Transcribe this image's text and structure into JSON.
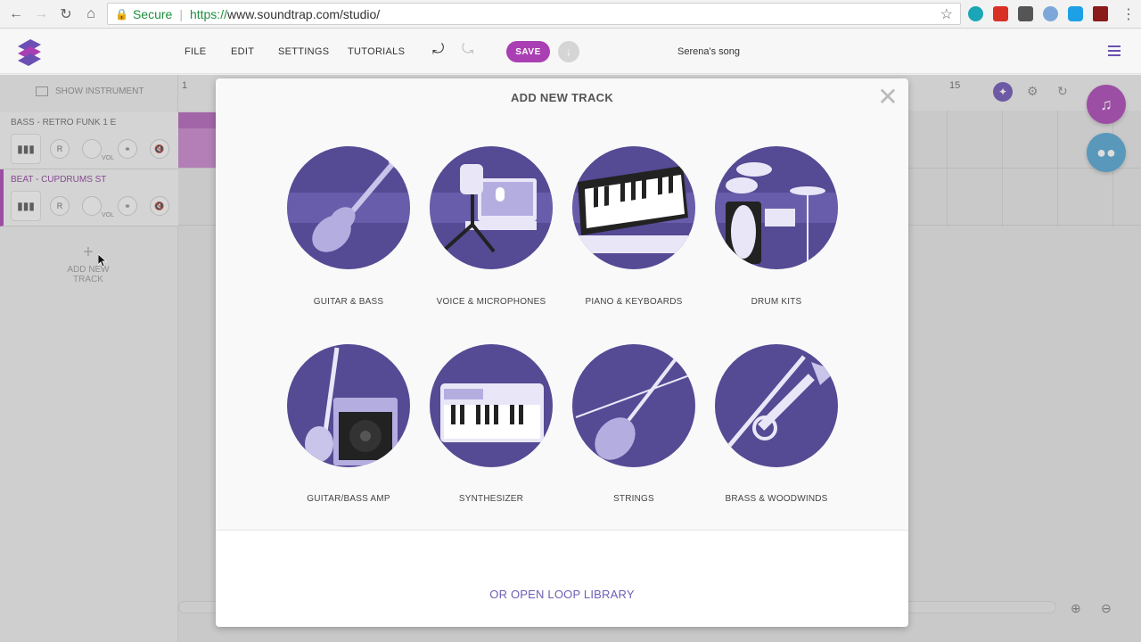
{
  "browser": {
    "secure_label": "Secure",
    "url_scheme": "https://",
    "url_rest": "www.soundtrap.com/studio/"
  },
  "header": {
    "menu": [
      "FILE",
      "EDIT",
      "SETTINGS",
      "TUTORIALS"
    ],
    "save_label": "SAVE",
    "song_title": "Serena's song",
    "accent_color": "#a93fb3"
  },
  "tracks_panel": {
    "show_instrument_label": "SHOW INSTRUMENT",
    "tracks": [
      {
        "name": "BASS - RETRO FUNK 1 E",
        "record": "R",
        "vol": "VOL"
      },
      {
        "name": "BEAT - CUPDRUMS ST",
        "record": "R",
        "vol": "VOL"
      }
    ],
    "add_track_label": "ADD NEW TRACK"
  },
  "timeline": {
    "ruler_numbers": [
      "1",
      "15"
    ]
  },
  "modal": {
    "title": "ADD NEW TRACK",
    "close_symbol": "✕",
    "tiles": [
      {
        "label": "GUITAR & BASS",
        "icon": "electric-guitar-icon"
      },
      {
        "label": "VOICE & MICROPHONES",
        "icon": "microphone-icon"
      },
      {
        "label": "PIANO & KEYBOARDS",
        "icon": "piano-keyboard-icon"
      },
      {
        "label": "DRUM KITS",
        "icon": "drum-kit-icon"
      },
      {
        "label": "GUITAR/BASS AMP",
        "icon": "amplifier-icon"
      },
      {
        "label": "SYNTHESIZER",
        "icon": "synthesizer-icon"
      },
      {
        "label": "STRINGS",
        "icon": "violin-icon"
      },
      {
        "label": "BRASS & WOODWINDS",
        "icon": "trumpet-icon"
      }
    ],
    "loop_library_label": "OR OPEN LOOP LIBRARY",
    "circle_color": "#554a94"
  }
}
